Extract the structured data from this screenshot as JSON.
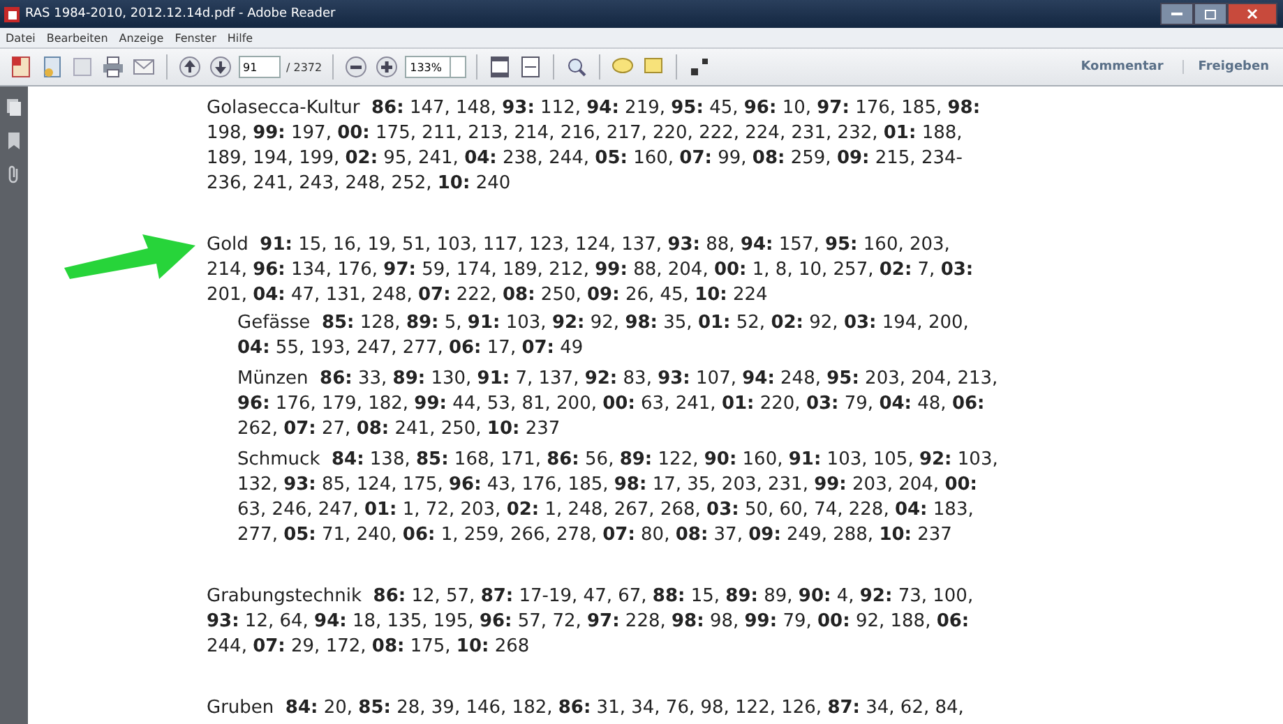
{
  "window": {
    "title": "RAS 1984-2010, 2012.12.14d.pdf - Adobe Reader"
  },
  "menu": [
    "Datei",
    "Bearbeiten",
    "Anzeige",
    "Fenster",
    "Hilfe"
  ],
  "toolbar": {
    "page": "91",
    "page_count": "/ 2372",
    "zoom": "133%",
    "panels": [
      "Kommentar",
      "Freigeben"
    ]
  },
  "entries": [
    {
      "lines": [
        "Golasecca-Kultur  **86:** 147, 148, **93:** 112, **94:** 219, **95:** 45, **96:** 10, **97:** 176, 185, **98:**",
        "198, **99:** 197, **00:** 175, 211, 213, 214, 216, 217, 220, 222, 224, 231, 232, **01:** 188,",
        "189, 194, 199, **02:** 95, 241, **04:** 238, 244, **05:** 160, **07:** 99, **08:** 259, **09:** 215, 234-",
        "236, 241, 243, 248, 252, **10:** 240"
      ]
    },
    {
      "lines": [
        "Gold  **91:** 15, 16, 19, 51, 103, 117, 123, 124, 137, **93:** 88, **94:** 157, **95:** 160, 203,",
        "214, **96:** 134, 176, **97:** 59, 174, 189, 212, **99:** 88, 204, **00:** 1, 8, 10, 257, **02:** 7, **03:**",
        "201, **04:** 47, 131, 248, **07:** 222, **08:** 250, **09:** 26, 45, **10:** 224"
      ],
      "children": [
        {
          "lines": [
            "Gefässe  **85:** 128, **89:** 5, **91:** 103, **92:** 92, **98:** 35, **01:** 52, **02:** 92, **03:** 194, 200,",
            "**04:** 55, 193, 247, 277, **06:** 17, **07:** 49"
          ]
        },
        {
          "lines": [
            "Münzen  **86:** 33, **89:** 130, **91:** 7, 137, **92:** 83, **93:** 107, **94:** 248, **95:** 203, 204, 213,",
            "**96:** 176, 179, 182, **99:** 44, 53, 81, 200, **00:** 63, 241, **01:** 220, **03:** 79, **04:** 48, **06:**",
            "262, **07:** 27, **08:** 241, 250, **10:** 237"
          ]
        },
        {
          "lines": [
            "Schmuck  **84:** 138, **85:** 168, 171, **86:** 56, **89:** 122, **90:** 160, **91:** 103, 105, **92:** 103,",
            "132, **93:** 85, 124, 175, **96:** 43, 176, 185, **98:** 17, 35, 203, 231, **99:** 203, 204, **00:**",
            "63, 246, 247, **01:** 1, 72, 203, **02:** 1, 248, 267, 268, **03:** 50, 60, 74, 228, **04:** 183,",
            "277, **05:** 71, 240, **06:** 1, 259, 266, 278, **07:** 80, **08:** 37, **09:** 249, 288, **10:** 237"
          ]
        }
      ]
    },
    {
      "lines": [
        "Grabungstechnik  **86:** 12, 57, **87:** 17-19, 47, 67, **88:** 15, **89:** 89, **90:** 4, **92:** 73, 100,",
        "**93:** 12, 64, **94:** 18, 135, 195, **96:** 57, 72, **97:** 228, **98:** 98, **99:** 79, **00:** 92, 188, **06:**",
        "244, **07:** 29, 172, **08:** 175, **10:** 268"
      ]
    },
    {
      "lines": [
        "Gruben  **84:** 20, **85:** 28, 39, 146, 182, **86:** 31, 34, 76, 98, 122, 126, **87:** 34, 62, 84,"
      ]
    }
  ]
}
